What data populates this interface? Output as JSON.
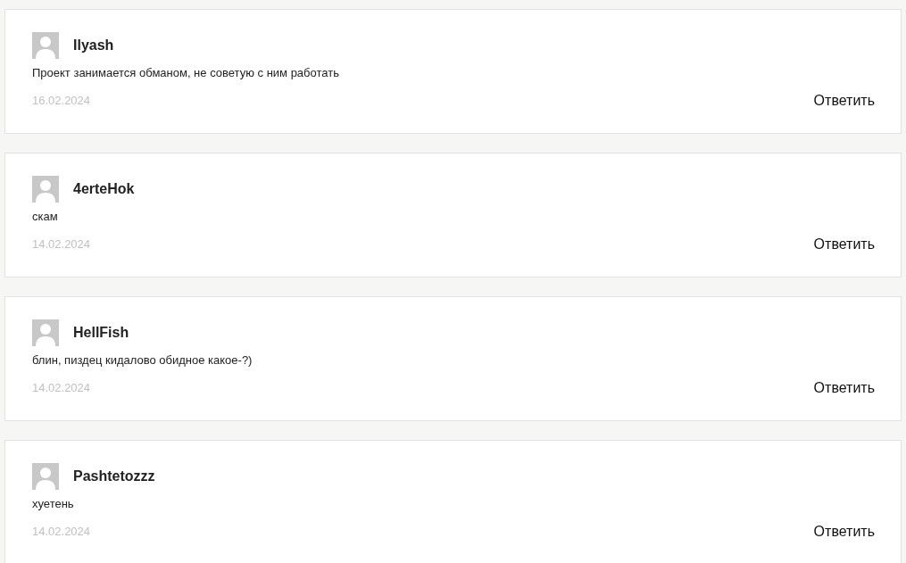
{
  "comments": [
    {
      "author": "Ilyash",
      "text": "Проект занимается обманом, не советую с ним работать",
      "date": "16.02.2024",
      "reply": "Ответить"
    },
    {
      "author": "4erteHok",
      "text": "скам",
      "date": "14.02.2024",
      "reply": "Ответить"
    },
    {
      "author": "HellFish",
      "text": "блин, пиздец кидалово обидное какое-?)",
      "date": "14.02.2024",
      "reply": "Ответить"
    },
    {
      "author": "Pashtetozzz",
      "text": "хуетень",
      "date": "14.02.2024",
      "reply": "Ответить"
    }
  ]
}
